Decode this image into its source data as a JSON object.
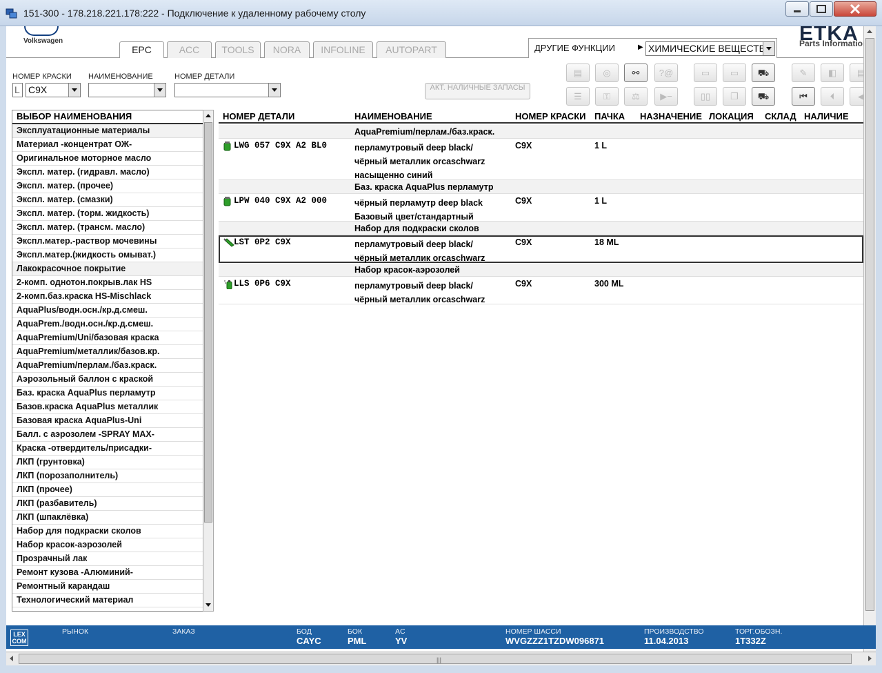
{
  "window": {
    "title": "151-300 - 178.218.221.178:222 - Подключение к удаленному рабочему столу"
  },
  "brand": {
    "vw_label": "Volkswagen",
    "etka": "ETKA",
    "etka_sub": "Parts Information"
  },
  "tabs": [
    {
      "label": "EPC",
      "active": true
    },
    {
      "label": "ACC",
      "active": false
    },
    {
      "label": "TOOLS",
      "active": false
    },
    {
      "label": "NORA",
      "active": false
    },
    {
      "label": "INFOLINE",
      "active": false
    },
    {
      "label": "AUTOPART",
      "active": false
    }
  ],
  "other_functions": {
    "label": "ДРУГИЕ ФУНКЦИИ",
    "selected": "ХИМИЧЕСКИЕ ВЕЩЕСТВА"
  },
  "filters": {
    "color_label": "НОМЕР КРАСКИ",
    "color_prefix": "L",
    "color_value": "C9X",
    "name_label": "НАИМЕНОВАНИЕ",
    "name_value": "",
    "part_label": "НОМЕР ДЕТАЛИ",
    "part_value": ""
  },
  "stock_button": "АКТ. НАЛИЧНЫЕ ЗАПАСЫ",
  "left_panel": {
    "header": "ВЫБОР НАИМЕНОВАНИЯ",
    "items": [
      {
        "label": "Эксплуатационные материалы",
        "group": true
      },
      {
        "label": "Материал -концентрат ОЖ-",
        "group": false
      },
      {
        "label": "Оригинальное моторное масло",
        "group": false
      },
      {
        "label": "Экспл. матер. (гидравл. масло)",
        "group": false
      },
      {
        "label": "Экспл. матер. (прочее)",
        "group": false
      },
      {
        "label": "Экспл. матер. (смазки)",
        "group": false
      },
      {
        "label": "Экспл. матер. (торм. жидкость)",
        "group": false
      },
      {
        "label": "Экспл. матер. (трансм. масло)",
        "group": false
      },
      {
        "label": "Экспл.матер.-раствор мочевины",
        "group": false
      },
      {
        "label": "Экспл.матер.(жидкость омыват.)",
        "group": false
      },
      {
        "label": "Лакокрасочное покрытие",
        "group": true
      },
      {
        "label": "2-комп. однотон.покрыв.лак HS",
        "group": false
      },
      {
        "label": "2-комп.баз.краска HS-Mischlack",
        "group": false
      },
      {
        "label": "AquaPlus/водн.осн./кр.д.смеш.",
        "group": false
      },
      {
        "label": "AquaPrem./водн.осн./кр.д.смеш.",
        "group": false
      },
      {
        "label": "AquaPremium/Uni/базовая краска",
        "group": false
      },
      {
        "label": "AquaPremium/металлик/базов.кр.",
        "group": false
      },
      {
        "label": "AquaPremium/перлам./баз.краск.",
        "group": false
      },
      {
        "label": "Аэрозольный баллон с краской",
        "group": false
      },
      {
        "label": "Баз. краска AquaPlus перламутр",
        "group": false
      },
      {
        "label": "Базов.краска AquaPlus металлик",
        "group": false
      },
      {
        "label": "Базовая краска AquaPlus-Uni",
        "group": false
      },
      {
        "label": "Балл. с аэрозолем  -SPRAY MAX-",
        "group": false
      },
      {
        "label": "Краска -отвердитель/присадки-",
        "group": false
      },
      {
        "label": "ЛКП (грунтовка)",
        "group": false
      },
      {
        "label": "ЛКП (порозаполнитель)",
        "group": false
      },
      {
        "label": "ЛКП (прочее)",
        "group": false
      },
      {
        "label": "ЛКП (разбавитель)",
        "group": false
      },
      {
        "label": "ЛКП (шпаклёвка)",
        "group": false
      },
      {
        "label": "Набор для подкраски сколов",
        "group": false
      },
      {
        "label": "Набор красок-аэрозолей",
        "group": false
      },
      {
        "label": "Прозрачный лак",
        "group": false
      },
      {
        "label": "Ремонт кузова -Алюминий-",
        "group": false
      },
      {
        "label": "Ремонтный карандаш",
        "group": false
      },
      {
        "label": "Технологический материал",
        "group": false
      }
    ]
  },
  "grid": {
    "columns": [
      "НОМЕР ДЕТАЛИ",
      "НАИМЕНОВАНИЕ",
      "НОМЕР КРАСКИ",
      "ПАЧКА",
      "НАЗНАЧЕНИЕ",
      "ЛОКАЦИЯ",
      "СКЛАД",
      "НАЛИЧИЕ"
    ],
    "groups": [
      {
        "title": "AquaPremium/перлам./баз.краск.",
        "part": "LWG 057 C9X A2 BL0",
        "icon": "paint-can-icon",
        "name_lines": [
          "перламутровый deep black/",
          "чёрный металлик orcaschwarz",
          "насыщенно синий"
        ],
        "color": "C9X",
        "pack": "1 L"
      },
      {
        "title": "Баз. краска AquaPlus перламутр",
        "part": "LPW 040 C9X A2 000",
        "icon": "paint-can-icon",
        "name_lines": [
          "чёрный перламутр deep black",
          "Базовый цвет/стандартный"
        ],
        "color": "C9X",
        "pack": "1 L"
      },
      {
        "title": "Набор для подкраски сколов",
        "part": "LST 0P2 C9X",
        "icon": "touch-up-pen-icon",
        "name_lines": [
          "перламутровый deep black/",
          "чёрный металлик orcaschwarz"
        ],
        "color": "C9X",
        "pack": "18 ML"
      },
      {
        "title": "Набор красок-аэрозолей",
        "part": "LLS 0P6 C9X",
        "icon": "spray-can-icon",
        "name_lines": [
          "перламутровый deep black/",
          "чёрный металлик orcaschwarz"
        ],
        "color": "C9X",
        "pack": "300 ML"
      }
    ]
  },
  "status": {
    "logo": "LEX COM",
    "market_label": "РЫНОК",
    "order_label": "ЗАКАЗ",
    "bod_label": "БОД",
    "bod_value": "CAYC",
    "bok_label": "БОК",
    "bok_value": "PML",
    "ac_label": "AC",
    "ac_value": "YV",
    "chassis_label": "НОМЕР ШАССИ",
    "chassis_value": "WVGZZZ1TZDW096871",
    "production_label": "ПРОИЗВОДСТВО",
    "production_value": "11.04.2013",
    "trade_label": "ТОРГ.ОБОЗН.",
    "trade_value": "1T332Z"
  },
  "colors": {
    "status_bar": "#1f61a4",
    "paint_green": "#2e9e2a"
  }
}
